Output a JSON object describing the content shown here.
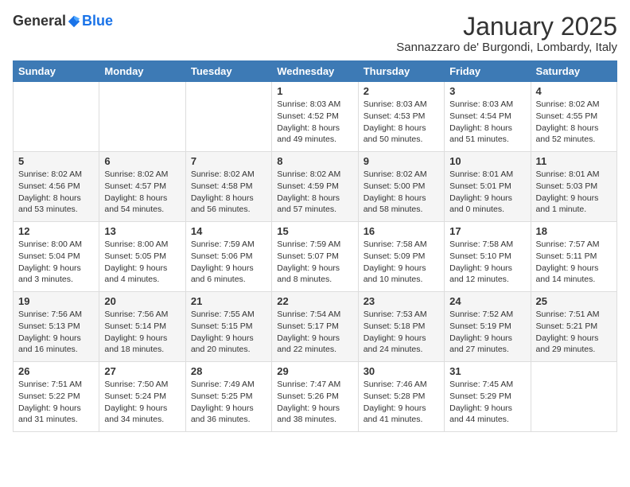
{
  "header": {
    "logo_general": "General",
    "logo_blue": "Blue",
    "month_title": "January 2025",
    "location": "Sannazzaro de' Burgondi, Lombardy, Italy"
  },
  "weekdays": [
    "Sunday",
    "Monday",
    "Tuesday",
    "Wednesday",
    "Thursday",
    "Friday",
    "Saturday"
  ],
  "weeks": [
    [
      {
        "day": "",
        "info": ""
      },
      {
        "day": "",
        "info": ""
      },
      {
        "day": "",
        "info": ""
      },
      {
        "day": "1",
        "info": "Sunrise: 8:03 AM\nSunset: 4:52 PM\nDaylight: 8 hours and 49 minutes."
      },
      {
        "day": "2",
        "info": "Sunrise: 8:03 AM\nSunset: 4:53 PM\nDaylight: 8 hours and 50 minutes."
      },
      {
        "day": "3",
        "info": "Sunrise: 8:03 AM\nSunset: 4:54 PM\nDaylight: 8 hours and 51 minutes."
      },
      {
        "day": "4",
        "info": "Sunrise: 8:02 AM\nSunset: 4:55 PM\nDaylight: 8 hours and 52 minutes."
      }
    ],
    [
      {
        "day": "5",
        "info": "Sunrise: 8:02 AM\nSunset: 4:56 PM\nDaylight: 8 hours and 53 minutes."
      },
      {
        "day": "6",
        "info": "Sunrise: 8:02 AM\nSunset: 4:57 PM\nDaylight: 8 hours and 54 minutes."
      },
      {
        "day": "7",
        "info": "Sunrise: 8:02 AM\nSunset: 4:58 PM\nDaylight: 8 hours and 56 minutes."
      },
      {
        "day": "8",
        "info": "Sunrise: 8:02 AM\nSunset: 4:59 PM\nDaylight: 8 hours and 57 minutes."
      },
      {
        "day": "9",
        "info": "Sunrise: 8:02 AM\nSunset: 5:00 PM\nDaylight: 8 hours and 58 minutes."
      },
      {
        "day": "10",
        "info": "Sunrise: 8:01 AM\nSunset: 5:01 PM\nDaylight: 9 hours and 0 minutes."
      },
      {
        "day": "11",
        "info": "Sunrise: 8:01 AM\nSunset: 5:03 PM\nDaylight: 9 hours and 1 minute."
      }
    ],
    [
      {
        "day": "12",
        "info": "Sunrise: 8:00 AM\nSunset: 5:04 PM\nDaylight: 9 hours and 3 minutes."
      },
      {
        "day": "13",
        "info": "Sunrise: 8:00 AM\nSunset: 5:05 PM\nDaylight: 9 hours and 4 minutes."
      },
      {
        "day": "14",
        "info": "Sunrise: 7:59 AM\nSunset: 5:06 PM\nDaylight: 9 hours and 6 minutes."
      },
      {
        "day": "15",
        "info": "Sunrise: 7:59 AM\nSunset: 5:07 PM\nDaylight: 9 hours and 8 minutes."
      },
      {
        "day": "16",
        "info": "Sunrise: 7:58 AM\nSunset: 5:09 PM\nDaylight: 9 hours and 10 minutes."
      },
      {
        "day": "17",
        "info": "Sunrise: 7:58 AM\nSunset: 5:10 PM\nDaylight: 9 hours and 12 minutes."
      },
      {
        "day": "18",
        "info": "Sunrise: 7:57 AM\nSunset: 5:11 PM\nDaylight: 9 hours and 14 minutes."
      }
    ],
    [
      {
        "day": "19",
        "info": "Sunrise: 7:56 AM\nSunset: 5:13 PM\nDaylight: 9 hours and 16 minutes."
      },
      {
        "day": "20",
        "info": "Sunrise: 7:56 AM\nSunset: 5:14 PM\nDaylight: 9 hours and 18 minutes."
      },
      {
        "day": "21",
        "info": "Sunrise: 7:55 AM\nSunset: 5:15 PM\nDaylight: 9 hours and 20 minutes."
      },
      {
        "day": "22",
        "info": "Sunrise: 7:54 AM\nSunset: 5:17 PM\nDaylight: 9 hours and 22 minutes."
      },
      {
        "day": "23",
        "info": "Sunrise: 7:53 AM\nSunset: 5:18 PM\nDaylight: 9 hours and 24 minutes."
      },
      {
        "day": "24",
        "info": "Sunrise: 7:52 AM\nSunset: 5:19 PM\nDaylight: 9 hours and 27 minutes."
      },
      {
        "day": "25",
        "info": "Sunrise: 7:51 AM\nSunset: 5:21 PM\nDaylight: 9 hours and 29 minutes."
      }
    ],
    [
      {
        "day": "26",
        "info": "Sunrise: 7:51 AM\nSunset: 5:22 PM\nDaylight: 9 hours and 31 minutes."
      },
      {
        "day": "27",
        "info": "Sunrise: 7:50 AM\nSunset: 5:24 PM\nDaylight: 9 hours and 34 minutes."
      },
      {
        "day": "28",
        "info": "Sunrise: 7:49 AM\nSunset: 5:25 PM\nDaylight: 9 hours and 36 minutes."
      },
      {
        "day": "29",
        "info": "Sunrise: 7:47 AM\nSunset: 5:26 PM\nDaylight: 9 hours and 38 minutes."
      },
      {
        "day": "30",
        "info": "Sunrise: 7:46 AM\nSunset: 5:28 PM\nDaylight: 9 hours and 41 minutes."
      },
      {
        "day": "31",
        "info": "Sunrise: 7:45 AM\nSunset: 5:29 PM\nDaylight: 9 hours and 44 minutes."
      },
      {
        "day": "",
        "info": ""
      }
    ]
  ]
}
